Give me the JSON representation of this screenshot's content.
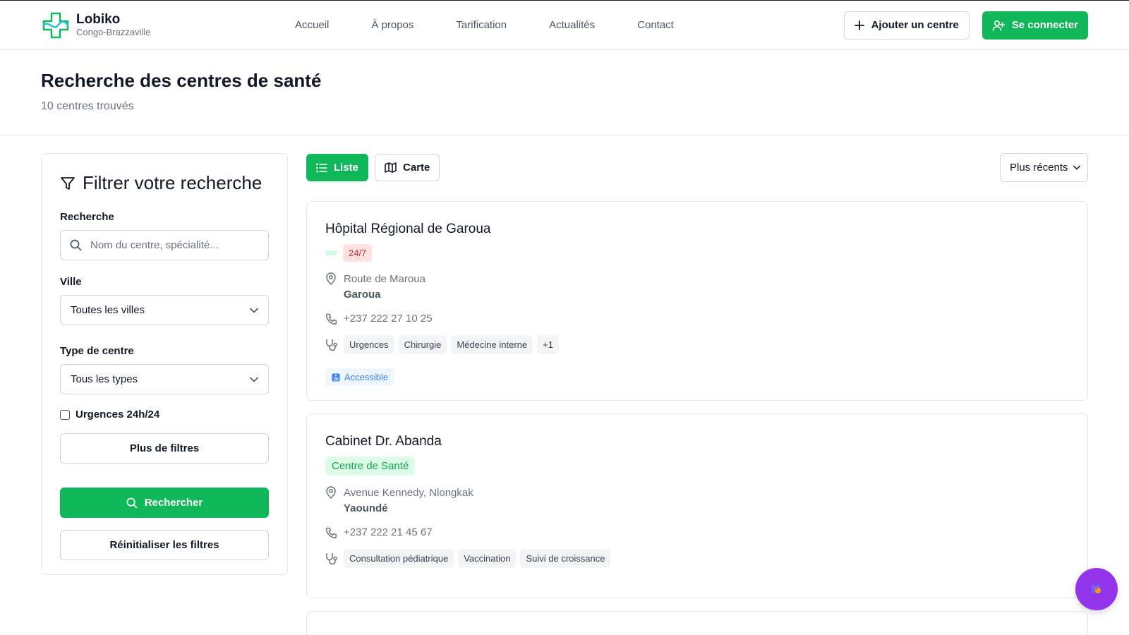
{
  "brand": {
    "name": "Lobiko",
    "subtitle": "Congo-Brazzaville"
  },
  "nav": {
    "items": [
      "Accueil",
      "À propos",
      "Tarification",
      "Actualités",
      "Contact"
    ]
  },
  "header_actions": {
    "add_center": "Ajouter un centre",
    "login": "Se connecter"
  },
  "page": {
    "title": "Recherche des centres de santé",
    "count": "10 centres trouvés"
  },
  "filters": {
    "title": "Filtrer votre recherche",
    "search_label": "Recherche",
    "search_placeholder": "Nom du centre, spécialité...",
    "city_label": "Ville",
    "city_value": "Toutes les villes",
    "type_label": "Type de centre",
    "type_value": "Tous les types",
    "emergency_label": "Urgences 24h/24",
    "more_filters": "Plus de filtres",
    "search_button": "Rechercher",
    "reset_button": "Réinitialiser les filtres"
  },
  "toolbar": {
    "list_label": "Liste",
    "map_label": "Carte",
    "sort_value": "Plus récents"
  },
  "centers": [
    {
      "name": "Hôpital Régional de Garoua",
      "badge": "24/7",
      "address": "Route de Maroua",
      "city": "Garoua",
      "phone": "+237 222 27 10 25",
      "tags": [
        "Urgences",
        "Chirurgie",
        "Médecine interne",
        "+1"
      ],
      "accessible": "Accessible"
    },
    {
      "name": "Cabinet Dr. Abanda",
      "badge": "Centre de Santé",
      "address": "Avenue Kennedy, Nlongkak",
      "city": "Yaoundé",
      "phone": "+237 222 21 45 67",
      "tags": [
        "Consultation pédiatrique",
        "Vaccination",
        "Suivi de croissance"
      ]
    }
  ],
  "colors": {
    "accent": "#10b759",
    "fab": "#9333ea",
    "danger": "#dc2626",
    "info": "#3b82f6"
  }
}
